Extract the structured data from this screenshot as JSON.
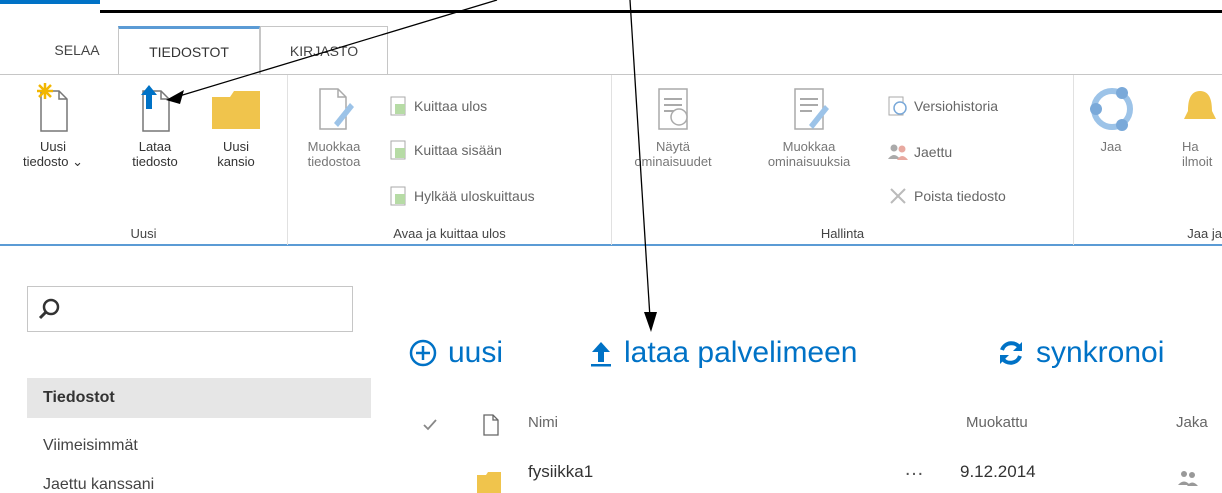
{
  "tabs": {
    "selaa": "SELAA",
    "tiedostot": "TIEDOSTOT",
    "kirjasto": "KIRJASTO"
  },
  "ribbon": {
    "uusi": {
      "label": "Uusi",
      "new_document": "Uusi\ntiedosto ⌄",
      "upload": "Lataa\ntiedosto",
      "new_folder": "Uusi\nkansio"
    },
    "open_checkout": {
      "label": "Avaa ja kuittaa ulos",
      "edit_document": "Muokkaa\ntiedostoa",
      "check_out": "Kuittaa ulos",
      "check_in": "Kuittaa sisään",
      "discard_checkout": "Hylkää uloskuittaus"
    },
    "manage": {
      "label": "Hallinta",
      "view_properties": "Näytä\nominaisuudet",
      "edit_properties": "Muokkaa\nominaisuuksia",
      "version_history": "Versiohistoria",
      "shared_with": "Jaettu",
      "delete_document": "Poista tiedosto"
    },
    "share": {
      "label": "Jaa ja",
      "share_btn": "Jaa",
      "alert_btn": "Ha\nilmoit"
    }
  },
  "left_nav": {
    "search_placeholder": "",
    "items": [
      "Tiedostot",
      "Viimeisimmät",
      "Jaettu kanssani"
    ]
  },
  "command_bar": {
    "new": "uusi",
    "upload": "lataa palvelimeen",
    "sync": "synkronoi"
  },
  "files": {
    "columns": {
      "name": "Nimi",
      "modified": "Muokattu",
      "shared": "Jaka"
    },
    "rows": [
      {
        "name": "fysiikka1",
        "more": "…",
        "modified": "9.12.2014"
      }
    ]
  },
  "colors": {
    "accent": "#0072c6",
    "tab_border": "#5b9bd5",
    "folder": "#f0c44c"
  }
}
